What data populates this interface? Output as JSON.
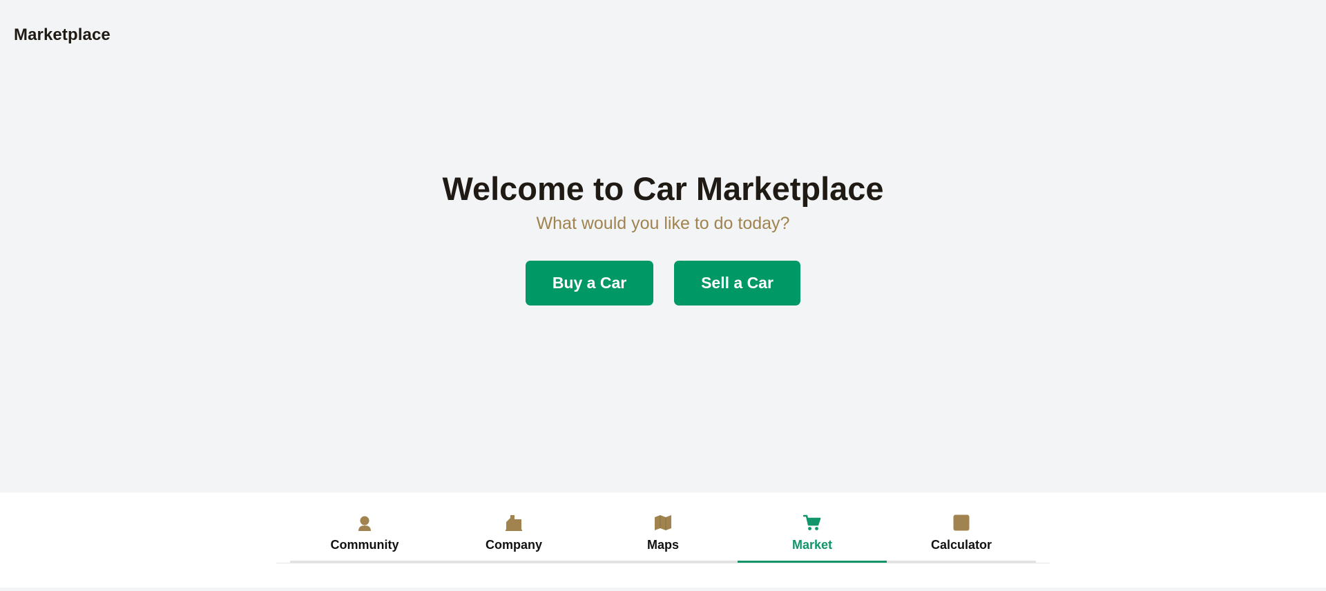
{
  "header": {
    "title": "Marketplace"
  },
  "hero": {
    "title": "Welcome to Car Marketplace",
    "subtitle": "What would you like to do today?",
    "buy_label": "Buy a Car",
    "sell_label": "Sell a Car"
  },
  "bottom_nav": {
    "tabs": [
      {
        "label": "Community",
        "icon": "person-icon"
      },
      {
        "label": "Company",
        "icon": "building-icon"
      },
      {
        "label": "Maps",
        "icon": "map-icon"
      },
      {
        "label": "Market",
        "icon": "cart-icon",
        "active": true
      },
      {
        "label": "Calculator",
        "icon": "calculator-icon"
      }
    ]
  },
  "colors": {
    "accent": "#009966",
    "active_tab": "#12956a",
    "icon": "#a0834f",
    "subtitle": "#a0834f",
    "background": "#f2f4f6"
  }
}
